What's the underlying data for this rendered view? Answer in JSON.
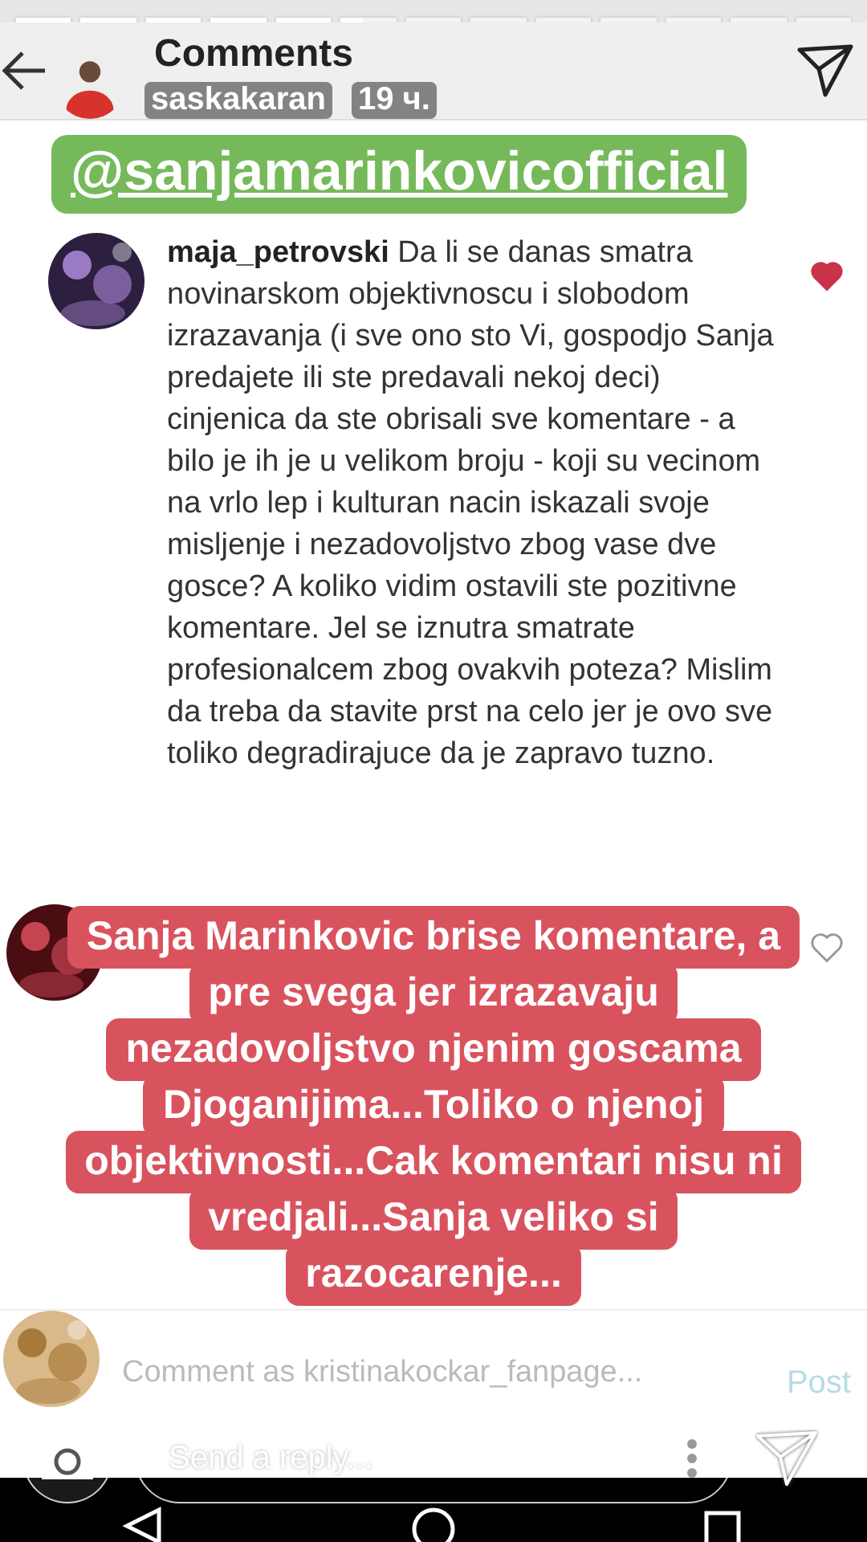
{
  "story_progress": [
    {
      "level": 1
    },
    {
      "level": 1
    },
    {
      "level": 1
    },
    {
      "level": 1
    },
    {
      "level": 1
    },
    {
      "level": 0.4
    },
    {
      "level": 0
    },
    {
      "level": 0
    },
    {
      "level": 0
    },
    {
      "level": 0
    },
    {
      "level": 0
    },
    {
      "level": 0
    },
    {
      "level": 0
    }
  ],
  "header": {
    "title": "Comments",
    "story_user": "saskakaran",
    "story_time": "19 ч."
  },
  "mention_sticker": "@sanjamarinkovicofficial",
  "comments": [
    {
      "text": "**maja_petrovski** Da li se danas smatra novinarskom objektivnoscu i slobodom izrazavanja (i sve ono sto Vi, gospodjo Sanja predajete ili ste predavali nekoj deci) cinjenica da ste obrisali sve komentare - a bilo je ih je u velikom broju - koji su vecinom na vrlo lep i kulturan nacin iskazali svoje misljenje i nezadovoljstvo zbog vase dve gosce? A koliko vidim ostavili ste pozitivne komentare. Jel se iznutra smatrate profesionalcem zbog ovakvih poteza? Mislim da treba da stavite prst na celo jer je ovo sve toliko degradirajuce da je zapravo tuzno.",
      "liked": true
    },
    {
      "liked": false
    }
  ],
  "caption_lines": [
    "Sanja Marinkovic brise komentare, a",
    "pre svega jer izrazavaju",
    "nezadovoljstvo njenim goscama",
    "Djoganijima...Toliko o njenoj",
    "objektivnosti...Cak komentari nisu ni",
    "vredjali...Sanja veliko si",
    "razocarenje..."
  ],
  "composer": {
    "placeholder": "Comment as kristinakockar_fanpage...",
    "post": "Post"
  },
  "reply_bar": {
    "placeholder": "Send a reply..."
  }
}
